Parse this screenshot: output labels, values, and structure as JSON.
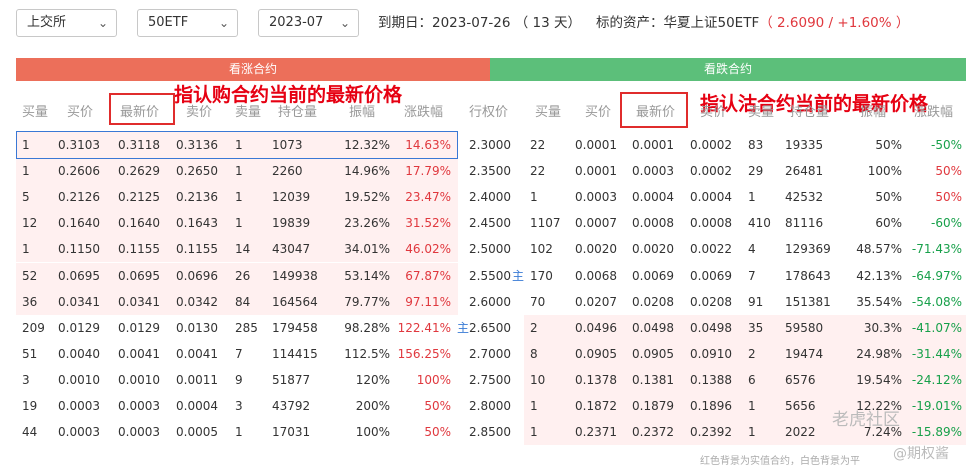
{
  "filters": {
    "exchange": "上交所",
    "underlying": "50ETF",
    "month": "2023-07"
  },
  "info": {
    "expiry_label": "到期日：",
    "expiry_value": "2023-07-26",
    "days": "（ 13 天）",
    "asset_label": "标的资产：",
    "asset_name": "华夏上证50ETF",
    "asset_price": "（ 2.6090 / +1.60% ）"
  },
  "bands": {
    "call": "看涨合约",
    "put": "看跌合约"
  },
  "annotations": {
    "call": "指认购合约当前的最新价格",
    "put": "指认沽合约当前的最新价格"
  },
  "headers": {
    "call": [
      "买量",
      "买价",
      "最新价",
      "卖价",
      "卖量",
      "持仓量",
      "振幅",
      "涨跌幅"
    ],
    "strike": "行权价",
    "put": [
      "买量",
      "买价",
      "最新价",
      "卖价",
      "卖量",
      "持仓量",
      "振幅",
      "涨跌幅"
    ]
  },
  "zhu_label": "主",
  "rows": [
    {
      "call": [
        "1",
        "0.3103",
        "0.3118",
        "0.3136",
        "1",
        "1073",
        "12.32%",
        "14.63%"
      ],
      "strike": "2.3000",
      "put": [
        "22",
        "0.0001",
        "0.0001",
        "0.0002",
        "83",
        "19335",
        "50%",
        "-50%"
      ],
      "call_itm": true,
      "put_itm": false,
      "put_chg_red": false
    },
    {
      "call": [
        "1",
        "0.2606",
        "0.2629",
        "0.2650",
        "1",
        "2260",
        "14.96%",
        "17.79%"
      ],
      "strike": "2.3500",
      "put": [
        "22",
        "0.0001",
        "0.0003",
        "0.0002",
        "29",
        "26481",
        "100%",
        "50%"
      ],
      "call_itm": true,
      "put_itm": false,
      "put_chg_red": true
    },
    {
      "call": [
        "5",
        "0.2126",
        "0.2125",
        "0.2136",
        "1",
        "12039",
        "19.52%",
        "23.47%"
      ],
      "strike": "2.4000",
      "put": [
        "1",
        "0.0003",
        "0.0004",
        "0.0004",
        "1",
        "42532",
        "50%",
        "50%"
      ],
      "call_itm": true,
      "put_itm": false,
      "put_chg_red": true
    },
    {
      "call": [
        "12",
        "0.1640",
        "0.1640",
        "0.1643",
        "1",
        "19839",
        "23.26%",
        "31.52%"
      ],
      "strike": "2.4500",
      "put": [
        "1107",
        "0.0007",
        "0.0008",
        "0.0008",
        "410",
        "81116",
        "60%",
        "-60%"
      ],
      "call_itm": true,
      "put_itm": false,
      "put_chg_red": false
    },
    {
      "call": [
        "1",
        "0.1150",
        "0.1155",
        "0.1155",
        "14",
        "43047",
        "34.01%",
        "46.02%"
      ],
      "strike": "2.5000",
      "put": [
        "102",
        "0.0020",
        "0.0020",
        "0.0022",
        "4",
        "129369",
        "48.57%",
        "-71.43%"
      ],
      "call_itm": true,
      "put_itm": false,
      "put_chg_red": false
    },
    {
      "call": [
        "52",
        "0.0695",
        "0.0695",
        "0.0696",
        "26",
        "149938",
        "53.14%",
        "67.87%"
      ],
      "strike": "2.5500",
      "put": [
        "170",
        "0.0068",
        "0.0069",
        "0.0069",
        "7",
        "178643",
        "42.13%",
        "-64.97%"
      ],
      "call_itm": true,
      "put_itm": false,
      "put_chg_red": false,
      "zhu": "put"
    },
    {
      "call": [
        "36",
        "0.0341",
        "0.0341",
        "0.0342",
        "84",
        "164564",
        "79.77%",
        "97.11%"
      ],
      "strike": "2.6000",
      "put": [
        "70",
        "0.0207",
        "0.0208",
        "0.0208",
        "91",
        "151381",
        "35.54%",
        "-54.08%"
      ],
      "call_itm": true,
      "put_itm": false,
      "put_chg_red": false
    },
    {
      "call": [
        "209",
        "0.0129",
        "0.0129",
        "0.0130",
        "285",
        "179458",
        "98.28%",
        "122.41%"
      ],
      "strike": "2.6500",
      "put": [
        "2",
        "0.0496",
        "0.0498",
        "0.0498",
        "35",
        "59580",
        "30.3%",
        "-41.07%"
      ],
      "call_itm": false,
      "put_itm": true,
      "put_chg_red": false,
      "zhu": "call"
    },
    {
      "call": [
        "51",
        "0.0040",
        "0.0041",
        "0.0041",
        "7",
        "114415",
        "112.5%",
        "156.25%"
      ],
      "strike": "2.7000",
      "put": [
        "8",
        "0.0905",
        "0.0905",
        "0.0910",
        "2",
        "19474",
        "24.98%",
        "-31.44%"
      ],
      "call_itm": false,
      "put_itm": true,
      "put_chg_red": false
    },
    {
      "call": [
        "3",
        "0.0010",
        "0.0010",
        "0.0011",
        "9",
        "51877",
        "120%",
        "100%"
      ],
      "strike": "2.7500",
      "put": [
        "10",
        "0.1378",
        "0.1381",
        "0.1388",
        "6",
        "6576",
        "19.54%",
        "-24.12%"
      ],
      "call_itm": false,
      "put_itm": true,
      "put_chg_red": false
    },
    {
      "call": [
        "19",
        "0.0003",
        "0.0003",
        "0.0004",
        "3",
        "43792",
        "200%",
        "50%"
      ],
      "strike": "2.8000",
      "put": [
        "1",
        "0.1872",
        "0.1879",
        "0.1896",
        "1",
        "5656",
        "12.22%",
        "-19.01%"
      ],
      "call_itm": false,
      "put_itm": true,
      "put_chg_red": false
    },
    {
      "call": [
        "44",
        "0.0003",
        "0.0003",
        "0.0005",
        "1",
        "17031",
        "100%",
        "50%"
      ],
      "strike": "2.8500",
      "put": [
        "1",
        "0.2371",
        "0.2372",
        "0.2392",
        "1",
        "2022",
        "7.24%",
        "-15.89%"
      ],
      "call_itm": false,
      "put_itm": true,
      "put_chg_red": false
    }
  ],
  "footnote": "红色背景为实值合约，白色背景为平",
  "watermarks": {
    "a": "老虎社区",
    "b": "@期权酱"
  },
  "colors": {
    "call_band": "#ec6f5a",
    "put_band": "#5cbf7a",
    "up": "#e0383e",
    "down": "#17a04a",
    "itm_bg": "#fff0f0"
  }
}
